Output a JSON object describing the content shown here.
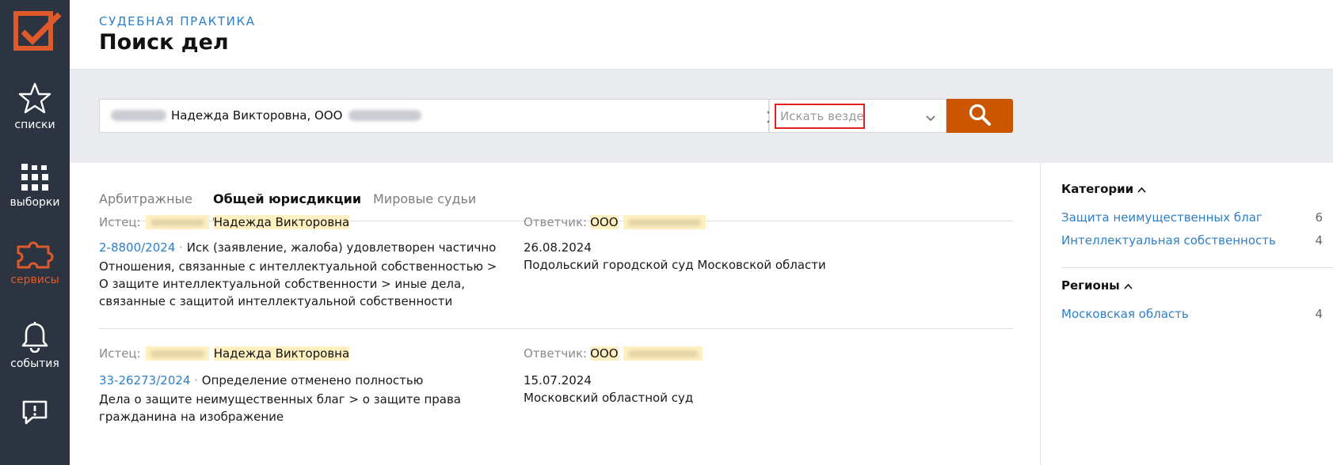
{
  "colors": {
    "rail_bg": "#2b3440",
    "accent": "#cc5500",
    "link": "#2f7fc6",
    "highlight": "#fff0c2",
    "band_bg": "#e9ebef",
    "focus_outline": "#e02020"
  },
  "rail": {
    "items": [
      {
        "label": "списки",
        "icon": "star-icon"
      },
      {
        "label": "выборки",
        "icon": "grid-icon"
      },
      {
        "label": "сервисы",
        "icon": "puzzle-icon"
      },
      {
        "label": "события",
        "icon": "bell-icon"
      },
      {
        "label": "",
        "icon": "feedback-icon"
      }
    ]
  },
  "header": {
    "section": "СУДЕБНАЯ ПРАКТИКА",
    "title": "Поиск дел"
  },
  "search": {
    "query_visible": "Надежда Викторовна, ООО",
    "scope_placeholder": "Искать везде"
  },
  "tabs": [
    {
      "label": "Арбитражные",
      "active": false
    },
    {
      "label": "Общей юрисдикции",
      "active": true
    },
    {
      "label": "Мировые судьи",
      "active": false
    }
  ],
  "cases": [
    {
      "plaintiff_label": "Истец:",
      "plaintiff_name": "Надежда Викторовна",
      "defendant_label": "Ответчик:",
      "defendant_prefix": "ООО",
      "number": "2-8800/2024",
      "separator": "·",
      "outcome": "Иск (заявление, жалоба) удовлетворен частично",
      "category": "Отношения, связанные с интеллектуальной собственностью > О защите интеллектуальной собственности > иные дела, связанные с защитой интеллектуальной собственности",
      "date": "26.08.2024",
      "court": "Подольский городской суд Московской области"
    },
    {
      "plaintiff_label": "Истец:",
      "plaintiff_name": "Надежда Викторовна",
      "defendant_label": "Ответчик:",
      "defendant_prefix": "ООО",
      "number": "33-26273/2024",
      "separator": "·",
      "outcome": "Определение отменено полностью",
      "category": "Дела о защите неимущественных благ > о защите права гражданина на изображение",
      "date": "15.07.2024",
      "court": "Московский областной суд"
    }
  ],
  "sidebar": {
    "categories": {
      "title": "Категории",
      "items": [
        {
          "label": "Защита неимущественных благ",
          "count": "6"
        },
        {
          "label": "Интеллектуальная собственность",
          "count": "4"
        }
      ]
    },
    "regions": {
      "title": "Регионы",
      "items": [
        {
          "label": "Московская область",
          "count": "4"
        }
      ]
    }
  }
}
